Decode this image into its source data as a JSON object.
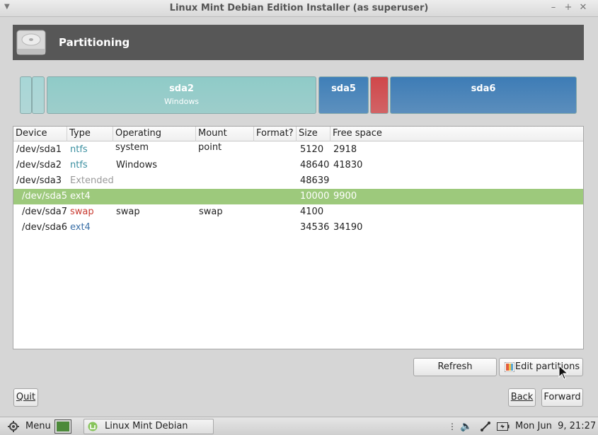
{
  "window": {
    "title": "Linux Mint Debian Edition Installer (as superuser)",
    "menu_glyph": "▼",
    "minimize": "–",
    "maximize": "+",
    "close": "✕"
  },
  "header": {
    "title": "Partitioning"
  },
  "partition_bar": [
    {
      "name": "",
      "sub": "",
      "color": "#a7d6d6"
    },
    {
      "name": "",
      "sub": "",
      "color": "#a7d6d6"
    },
    {
      "name": "sda2",
      "sub": "Windows",
      "color": "#8fcbc8"
    },
    {
      "name": "sda5",
      "sub": "",
      "color": "#3f7fb8"
    },
    {
      "name": "",
      "sub": "",
      "color": "#d0474a"
    },
    {
      "name": "sda6",
      "sub": "",
      "color": "#3d7cb6"
    }
  ],
  "table": {
    "columns": [
      "Device",
      "Type",
      "Operating system",
      "Mount point",
      "Format?",
      "Size",
      "Free space"
    ],
    "rows": [
      {
        "device": "/dev/sda1",
        "type": "ntfs",
        "type_color": "#3a8fa0",
        "os": "",
        "mount": "",
        "format": "",
        "size": "5120",
        "free": "2918"
      },
      {
        "device": "/dev/sda2",
        "type": "ntfs",
        "type_color": "#3a8fa0",
        "os": "Windows",
        "mount": "",
        "format": "",
        "size": "48640",
        "free": "41830"
      },
      {
        "device": "/dev/sda3",
        "type": "Extended",
        "type_color": "#9a9a9a",
        "os": "",
        "mount": "",
        "format": "",
        "size": "48639",
        "free": ""
      },
      {
        "device": "/dev/sda5",
        "type": "ext4",
        "type_color": "#3a6fa6",
        "os": "",
        "mount": "",
        "format": "",
        "size": "10000",
        "free": "9900"
      },
      {
        "device": "/dev/sda7",
        "type": "swap",
        "type_color": "#c8392f",
        "os": "swap",
        "mount": "swap",
        "format": "",
        "size": "4100",
        "free": ""
      },
      {
        "device": "/dev/sda6",
        "type": "ext4",
        "type_color": "#3a6fa6",
        "os": "",
        "mount": "",
        "format": "",
        "size": "34536",
        "free": "34190"
      }
    ]
  },
  "buttons": {
    "refresh": "Refresh",
    "edit_partitions": "Edit partitions",
    "quit": "Quit",
    "back": "Back",
    "forward": "Forward"
  },
  "taskbar": {
    "menu": "Menu",
    "task": "Linux Mint Debian Edi...",
    "clock": "Mon Jun  9, 21:27"
  }
}
